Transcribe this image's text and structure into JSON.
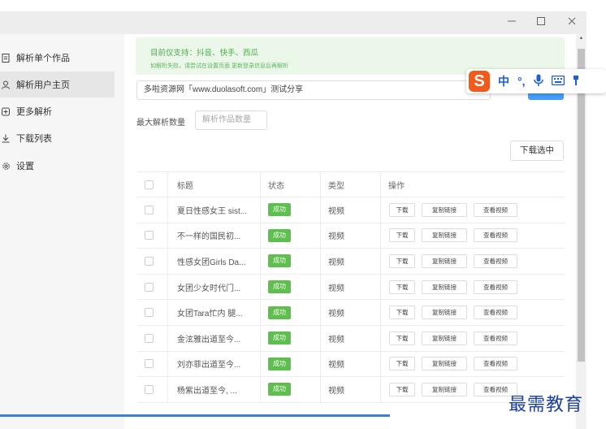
{
  "window": {
    "minimize_icon": "minimize-icon",
    "maximize_icon": "maximize-icon",
    "close_icon": "close-icon"
  },
  "sidebar": {
    "items": [
      {
        "label": "解析单个作品",
        "icon": "document-icon",
        "active": false
      },
      {
        "label": "解析用户主页",
        "icon": "user-icon",
        "active": true
      },
      {
        "label": "更多解析",
        "icon": "plus-icon",
        "active": false
      },
      {
        "label": "下载列表",
        "icon": "download-icon",
        "active": false
      },
      {
        "label": "设置",
        "icon": "gear-icon",
        "active": false
      }
    ]
  },
  "notice": {
    "title": "目前仅支持：抖音、快手、西瓜",
    "subtitle": "如解析失败，请尝试在设置页面 更新登录信息后再解析"
  },
  "url_input": {
    "value": "多啦资源网「www.duolasoft.com」测试分享"
  },
  "max_count": {
    "label": "最大解析数量",
    "placeholder": "解析作品数量"
  },
  "download_selected_label": "下载选中",
  "table": {
    "headers": {
      "title": "标题",
      "status": "状态",
      "type": "类型",
      "actions": "操作"
    },
    "action_labels": {
      "download": "下载",
      "copy": "复制链接",
      "view": "查看视频"
    },
    "rows": [
      {
        "title": "夏日性感女王 sist...",
        "status": "成功",
        "type": "视频"
      },
      {
        "title": "不一样的国民初...",
        "status": "成功",
        "type": "视频"
      },
      {
        "title": "性感女团Girls Da...",
        "status": "成功",
        "type": "视频"
      },
      {
        "title": "女团少女时代门...",
        "status": "成功",
        "type": "视频"
      },
      {
        "title": "女团Tara忙内 腿...",
        "status": "成功",
        "type": "视频"
      },
      {
        "title": "金泫雅出道至今...",
        "status": "成功",
        "type": "视频"
      },
      {
        "title": "刘亦菲出道至今...",
        "status": "成功",
        "type": "视频"
      },
      {
        "title": "杨紫出道至今, ...",
        "status": "成功",
        "type": "视频"
      }
    ]
  },
  "ime": {
    "logo": "S",
    "mode": "中",
    "punct": "°,",
    "mic_icon": "microphone-icon",
    "keyboard_icon": "keyboard-icon"
  },
  "watermark": "最需教育",
  "colors": {
    "accent": "#409eff",
    "success": "#5fbe4f",
    "notice_bg": "#eaf7e9",
    "ime_brand": "#f25a1c"
  }
}
